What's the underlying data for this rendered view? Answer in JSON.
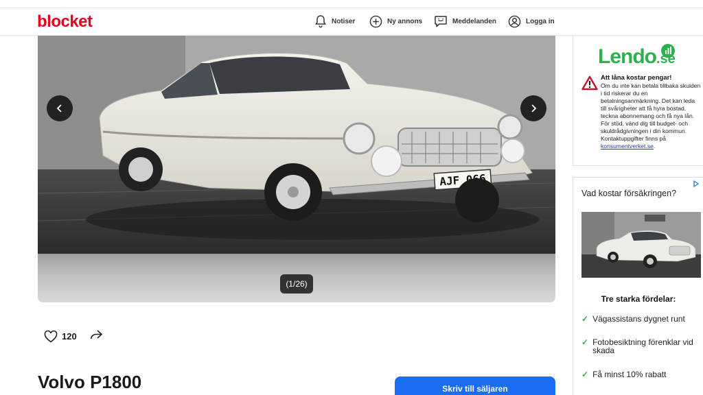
{
  "header": {
    "logo": "blocket",
    "nav": [
      {
        "label": "Notiser",
        "icon": "bell-icon"
      },
      {
        "label": "Ny annons",
        "icon": "plus-circle-icon"
      },
      {
        "label": "Meddelanden",
        "icon": "chat-icon"
      },
      {
        "label": "Logga in",
        "icon": "user-circle-icon"
      }
    ]
  },
  "gallery": {
    "counter": "(1/26)",
    "plate": "AJF 066",
    "prev_icon": "chevron-left-icon",
    "next_icon": "chevron-right-icon"
  },
  "actions": {
    "likes": "120",
    "like_icon": "heart-icon",
    "share_icon": "share-icon"
  },
  "listing": {
    "title": "Volvo P1800",
    "contact_label": "Skriv till säljaren"
  },
  "ad_lendo": {
    "brand": "Lendo",
    "brand_suffix": ".se",
    "warning_title": "Att låna kostar pengar!",
    "warning_text": "Om du inte kan betala tillbaka skulden i tid riskerar du en betalningsanmärkning. Det kan leda till svårigheter att få hyra bostad, teckna abonnemang och få nya lån. För stöd, vänd dig till budget- och skuldrådgivningen i din kommun. Kontaktuppgifter finns på",
    "warning_link": "konsumentverket.se",
    "warning_end": "."
  },
  "ad_insurance": {
    "title": "Vad kostar försäkringen?",
    "subtitle": "Tre starka fördelar:",
    "features": [
      "Vägassistans dygnet runt",
      "Fotobesiktning förenklar vid skada",
      "Få minst 10% rabatt"
    ]
  },
  "colors": {
    "brand_red": "#e8001c",
    "cta_blue": "#1b6ef3",
    "lendo_green": "#2bb24c"
  }
}
